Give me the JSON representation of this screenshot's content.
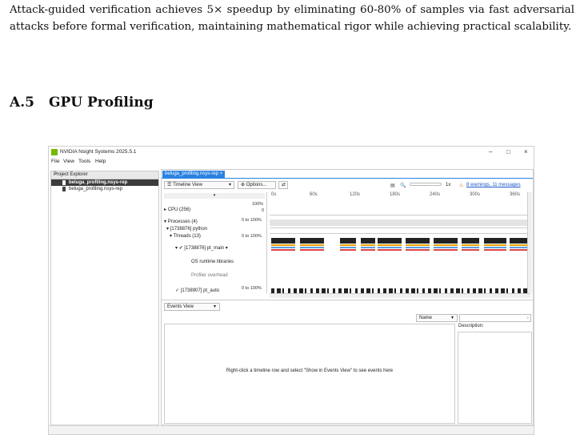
{
  "paragraph": "Attack-guided verification achieves 5× speedup by eliminating 60-80% of samples via fast adversarial attacks before formal verification, maintaining mathematical rigor while achieving practical scalability.",
  "section": {
    "number": "A.5",
    "title": "GPU Profiling"
  },
  "app": {
    "title": "NVIDIA Nsight Systems 2025.5.1",
    "window_controls": {
      "minimize": "–",
      "maximize": "□",
      "close": "×"
    },
    "menu": [
      "File",
      "View",
      "Tools",
      "Help"
    ],
    "project_explorer": {
      "header": "Project Explorer",
      "close": "×",
      "items": [
        "beluga_profiling.nsys-rep",
        "beluga_profiling.nsys-rep"
      ]
    },
    "tab": "beluga_profiling.nsys-rep ×",
    "toolbar": {
      "view": "☰ Timeline View",
      "options": "⊕ Options...",
      "pin": "⇄",
      "zoom": "1x",
      "warnings": "8 warnings, 11 messages"
    },
    "ruler": [
      "0s",
      "60s",
      "120s",
      "180s",
      "240s",
      "300s",
      "360s"
    ],
    "rows": {
      "cpu": "CPU (256)",
      "processes": "Processes (4)",
      "python": "[1738876] python",
      "threads": "Threads (13)",
      "pt_main": "[1738876] pt_main",
      "os_runtime": "OS runtime libraries",
      "profiler": "Profiler overhead",
      "pt_auto": "[1738907] pt_auto"
    },
    "pct": {
      "hundred": "100%",
      "zero": "0",
      "range": "0 to 100%"
    },
    "events": {
      "dropdown": "Events View",
      "name_dropdown": "Name",
      "message": "Right-click a timeline row and select \"Show in Events View\" to see events here",
      "description": "Description:"
    },
    "colors": {
      "accent": "#2b82e0",
      "warn": "#c78a00",
      "nvidia": "#76b900"
    }
  }
}
